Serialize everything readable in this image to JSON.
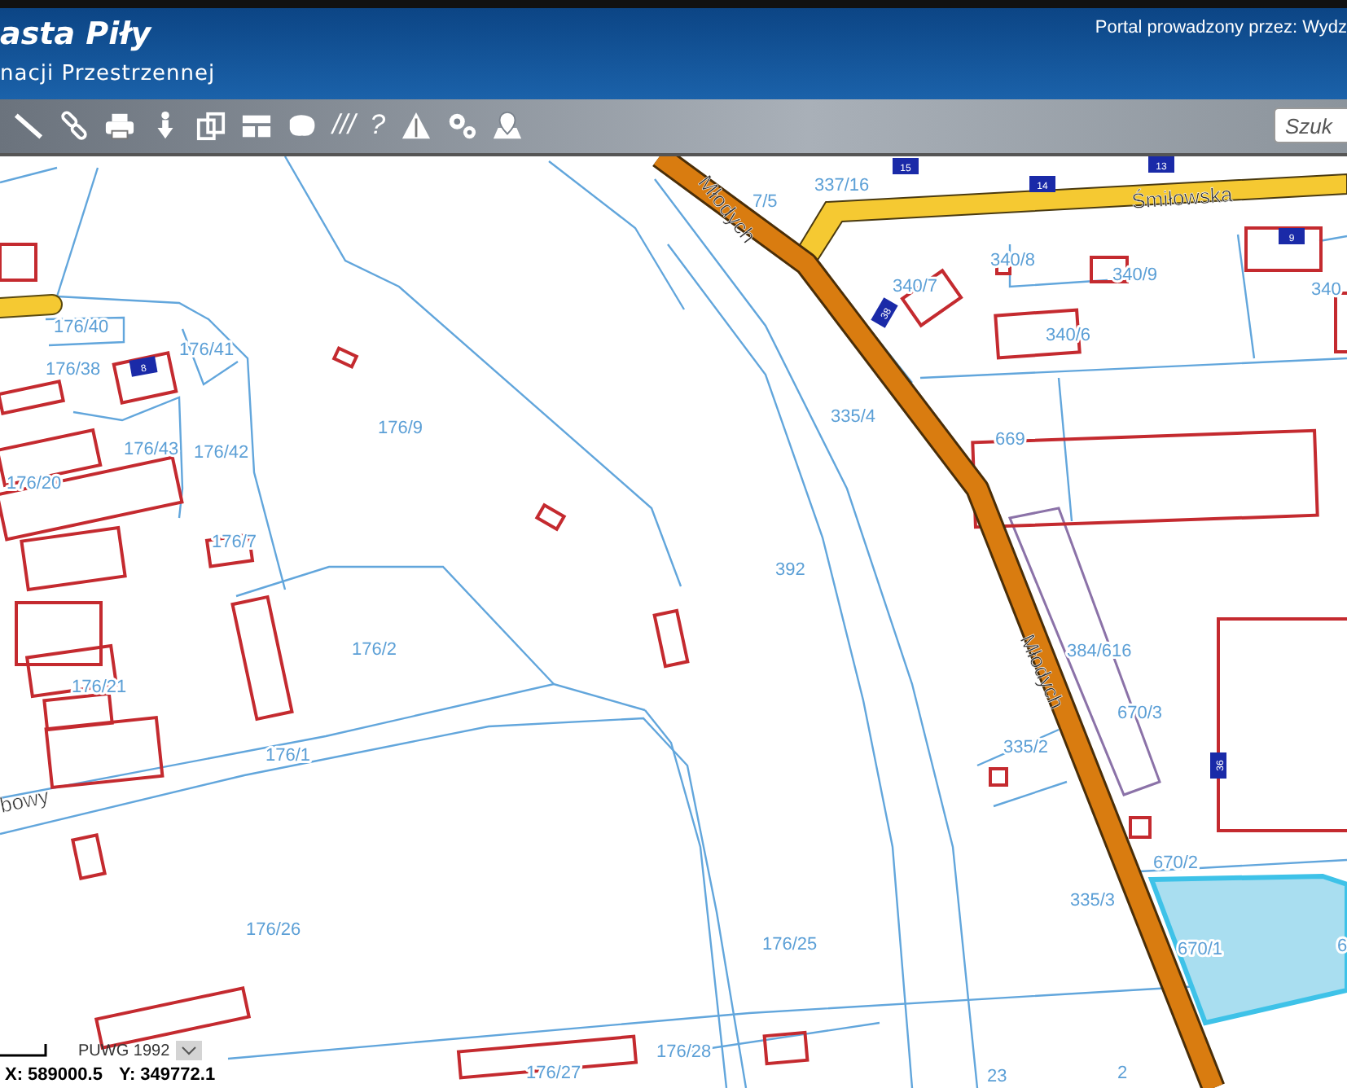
{
  "header": {
    "title": "asta Piły",
    "subtitle": "nacji Przestrzennej",
    "operator_text": "Portal prowadzony przez: Wydz"
  },
  "toolbar": {
    "text_tools": [
      "///",
      "?"
    ],
    "search": {
      "placeholder": "Szuk"
    }
  },
  "map": {
    "streets": [
      "Młodych",
      "Śmiłowska",
      "Młodych",
      "bowy"
    ],
    "parcels": [
      "7/5",
      "337/16",
      "340/8",
      "340/9",
      "340/7",
      "340/6",
      "340",
      "335/4",
      "669",
      "392",
      "176/40",
      "176/41",
      "176/38",
      "176/9",
      "176/43",
      "176/42",
      "176/20",
      "176/7",
      "176/2",
      "176/21",
      "176/1",
      "384/616",
      "670/3",
      "335/2",
      "670/2",
      "335/3",
      "670/1",
      "6",
      "176/26",
      "176/25",
      "176/28",
      "176/27",
      "23",
      "2"
    ],
    "house_numbers": [
      "15",
      "14",
      "13",
      "9",
      "8",
      "38",
      "36"
    ]
  },
  "status": {
    "crs": "PUWG 1992",
    "x": "X: 589000.5",
    "y": "Y: 349772.1"
  }
}
